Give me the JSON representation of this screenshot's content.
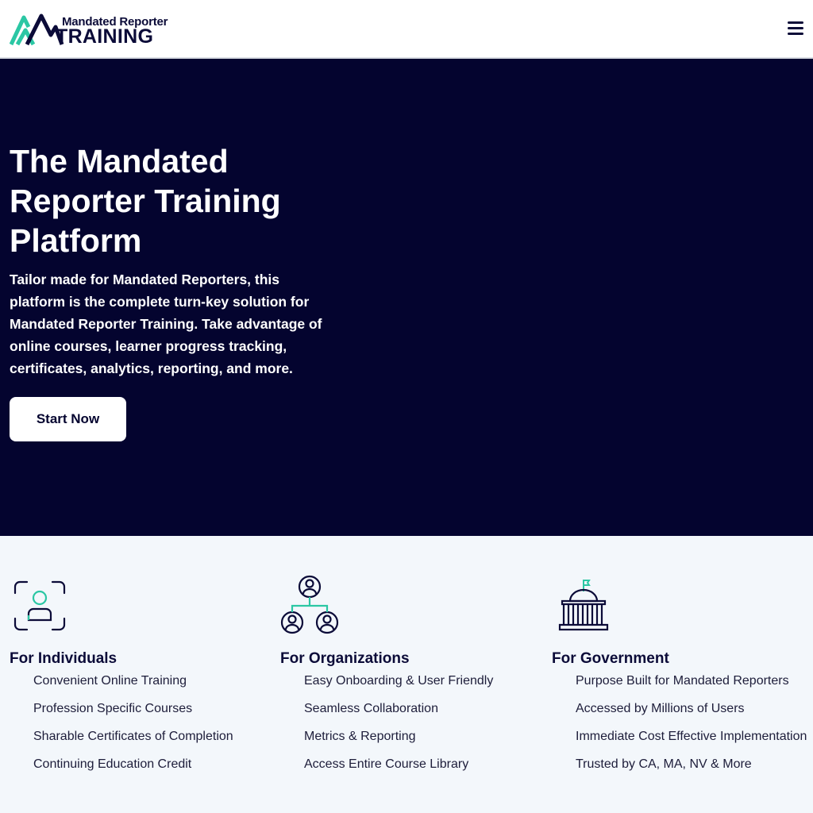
{
  "header": {
    "logo_top": "Mandated Reporter",
    "logo_main": "TRAINING",
    "menu_icon": "hamburger-menu-icon"
  },
  "hero": {
    "title": "The Mandated Reporter Training Platform",
    "description": "Tailor made for Mandated Reporters, this platform is the complete turn-key solution for Mandated Reporter Training. Take advantage of online courses, learner progress tracking, certificates, analytics, reporting, and more.",
    "cta_label": "Start Now"
  },
  "features": {
    "individuals": {
      "icon": "person-focus-icon",
      "title": "For Individuals",
      "items": [
        "Convenient Online Training",
        "Profession Specific Courses",
        "Sharable Certificates of Completion",
        "Continuing Education Credit"
      ]
    },
    "organizations": {
      "icon": "org-chart-icon",
      "title": "For Organizations",
      "items": [
        "Easy Onboarding & User Friendly",
        "Seamless Collaboration",
        "Metrics & Reporting",
        "Access Entire Course Library"
      ]
    },
    "government": {
      "icon": "capitol-building-icon",
      "title": "For Government",
      "items": [
        "Purpose Built for Mandated Reporters",
        "Accessed by Millions of Users",
        "Immediate Cost Effective Implementation",
        "Trusted by CA, MA, NV & More"
      ]
    }
  },
  "colors": {
    "navy": "#04042f",
    "accent_teal": "#2bc7a4",
    "background": "#f3f7fb"
  }
}
